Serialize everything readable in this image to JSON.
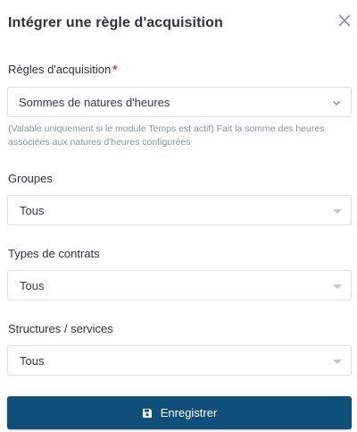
{
  "modal": {
    "title": "Intégrer une règle d'acquisition",
    "close_icon": "close-icon"
  },
  "form": {
    "rule": {
      "label": "Règles d'acquisition",
      "required_mark": "*",
      "value": "Sommes de natures d'heures",
      "help": "(Valable uniquement si le module Temps est actif) Fait la somme des heures associées aux natures d'heures configurées"
    },
    "groups": {
      "label": "Groupes",
      "value": "Tous"
    },
    "contract_types": {
      "label": "Types de contrats",
      "value": "Tous"
    },
    "structures": {
      "label": "Structures / services",
      "value": "Tous"
    }
  },
  "footer": {
    "save_label": "Enregistrer",
    "save_icon": "floppy-disk-icon"
  },
  "colors": {
    "primary_button": "#0f4f7a",
    "required": "#d0303a",
    "border": "#dcdfe3",
    "help_text": "#8b949c"
  }
}
